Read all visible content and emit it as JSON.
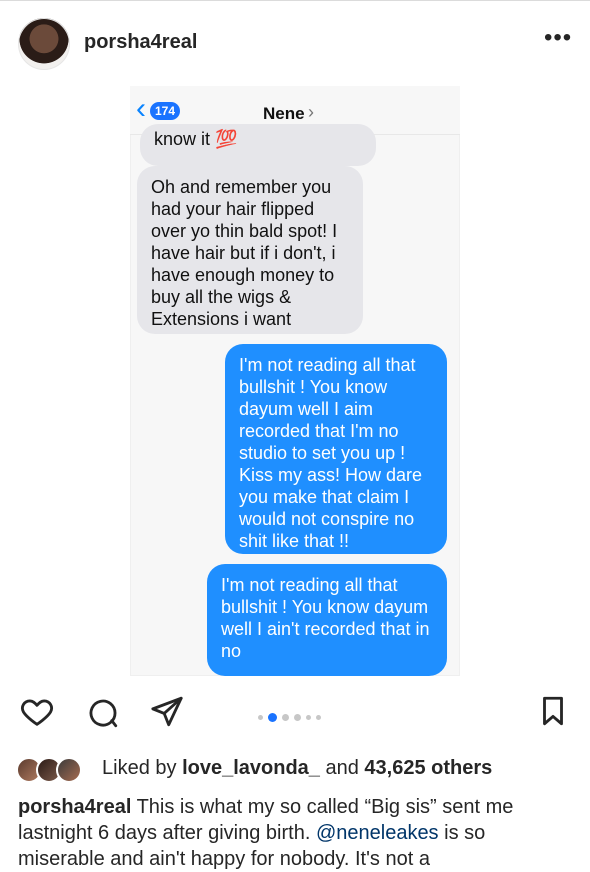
{
  "post": {
    "username": "porsha4real",
    "more_label": "•••"
  },
  "sms": {
    "back_count": "174",
    "contact_name": "Nene",
    "messages": [
      {
        "side": "left",
        "text": "know it 💯"
      },
      {
        "side": "left",
        "text": "Oh and remember you had your hair flipped over yo thin bald spot! I have hair but if i don't, i have enough money to buy all the wigs & Extensions i want"
      },
      {
        "side": "right",
        "text": "I'm not reading all that bullshit ! You know dayum well I aim recorded that I'm no studio to set you up ! Kiss my ass! How dare you make that claim I would not conspire no shit like that !!"
      },
      {
        "side": "right",
        "text": "I'm not reading all that bullshit ! You know dayum well I ain't recorded that in no"
      }
    ]
  },
  "actions": {
    "like_icon": "heart-icon",
    "comment_icon": "comment-icon",
    "share_icon": "share-icon",
    "save_icon": "bookmark-icon",
    "carousel_count": 6,
    "carousel_active_index": 1
  },
  "likes": {
    "prefix": "Liked by",
    "first_user": "love_lavonda_",
    "middle": "and",
    "count_text": "43,625 others"
  },
  "caption": {
    "username": "porsha4real",
    "text_part1": "This is what my so called “Big sis” sent me lastnight 6 days after giving birth.",
    "mention": "@neneleakes",
    "text_part2": "is so miserable and ain't happy for nobody. It's not a"
  }
}
